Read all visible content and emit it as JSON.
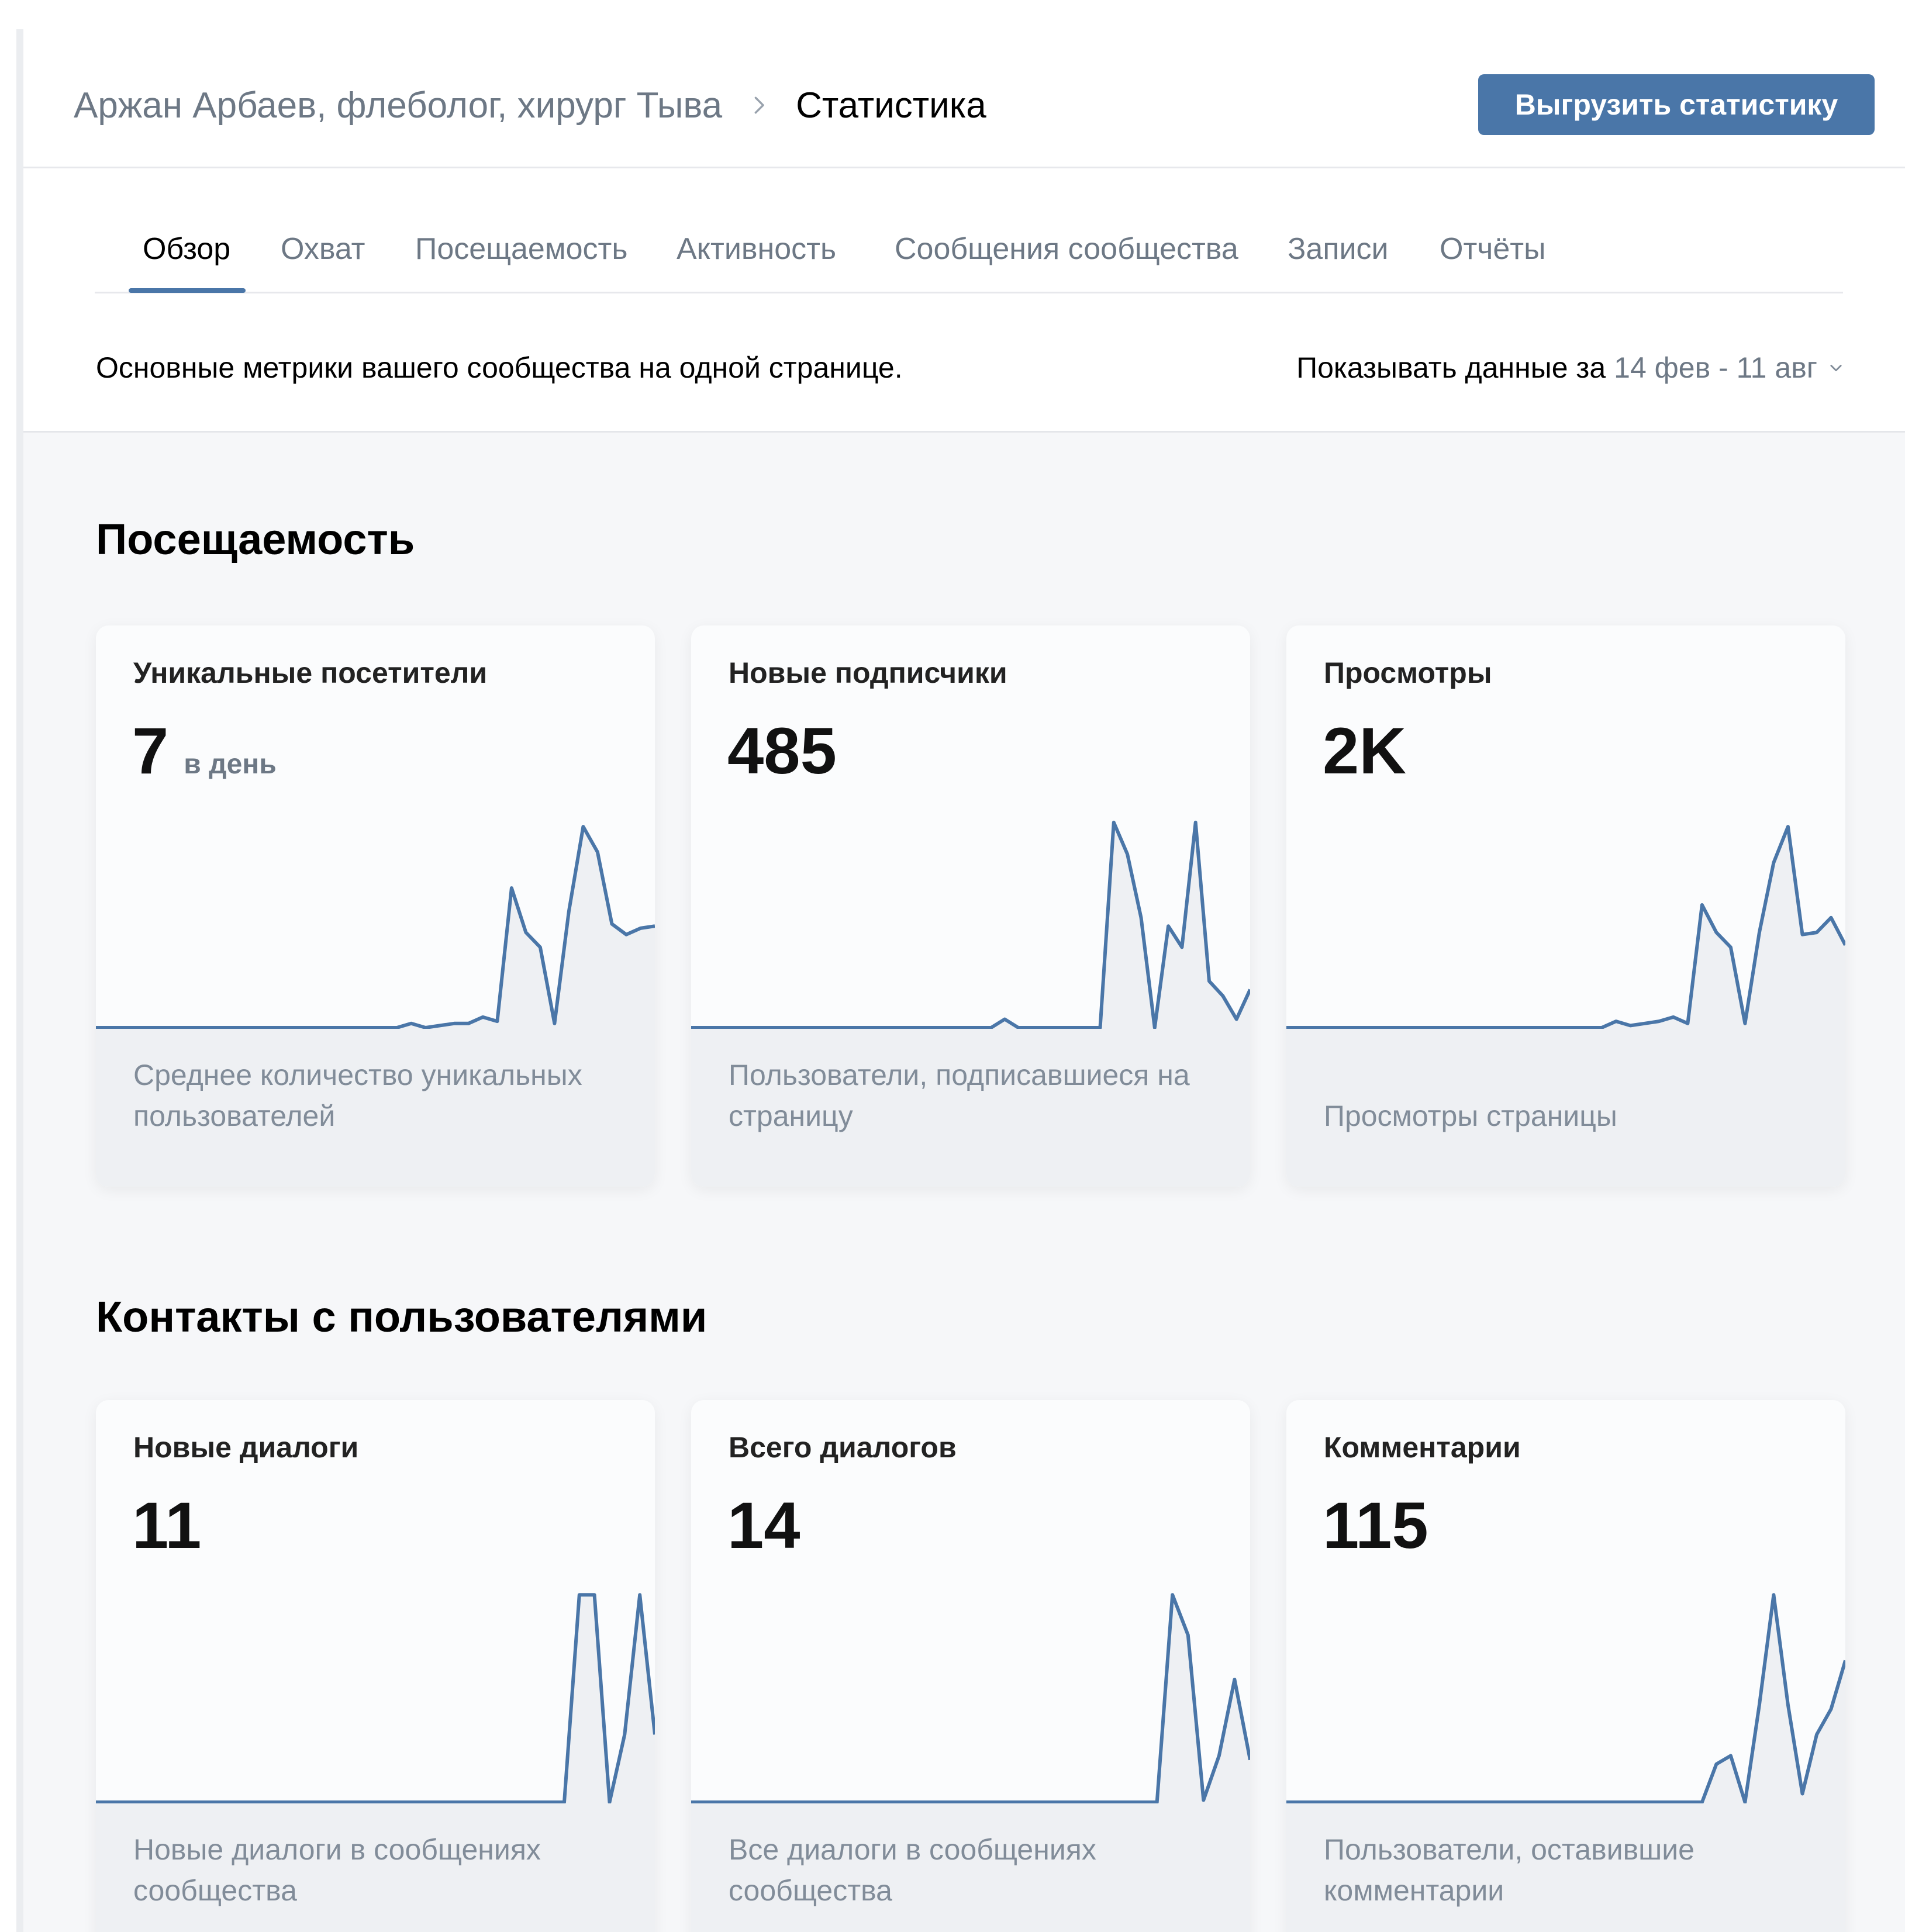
{
  "header": {
    "breadcrumb_parent": "Аржан Арбаев, флеболог, хирург Тыва",
    "breadcrumb_current": "Статистика",
    "export_button": "Выгрузить статистику"
  },
  "tabs": [
    {
      "label": "Обзор",
      "active": true
    },
    {
      "label": "Охват",
      "active": false
    },
    {
      "label": "Посещаемость",
      "active": false
    },
    {
      "label": "Активность",
      "active": false
    },
    {
      "label": "Сообщения сообщества",
      "active": false
    },
    {
      "label": "Записи",
      "active": false
    },
    {
      "label": "Отчёты",
      "active": false
    }
  ],
  "description": "Основные метрики вашего сообщества на одной странице.",
  "period": {
    "label": "Показывать данные за",
    "value": "14 фев - 11 авг"
  },
  "colors": {
    "accent": "#4a76a8",
    "line": "#4a76a8",
    "muted": "#818c99"
  },
  "sections": [
    {
      "title": "Посещаемость",
      "cards": [
        {
          "title": "Уникальные посетители",
          "value": "7",
          "unit": "в день",
          "caption": "Среднее количество уникальных пользователей",
          "series": [
            0,
            0,
            0,
            0,
            0,
            0,
            0,
            0,
            0,
            0,
            0,
            0,
            0,
            0,
            0,
            0,
            0,
            0,
            0,
            0,
            0,
            0,
            0.02,
            0,
            0.01,
            0.02,
            0.02,
            0.05,
            0.03,
            0.66,
            0.45,
            0.38,
            0.02,
            0.55,
            0.95,
            0.83,
            0.49,
            0.44,
            0.47,
            0.48
          ]
        },
        {
          "title": "Новые подписчики",
          "value": "485",
          "unit": "",
          "caption": "Пользователи, подписавшиеся на страницу",
          "series": [
            0,
            0,
            0,
            0,
            0,
            0,
            0,
            0,
            0,
            0,
            0,
            0,
            0,
            0,
            0,
            0,
            0,
            0,
            0,
            0,
            0,
            0,
            0,
            0.04,
            0,
            0,
            0,
            0,
            0,
            0,
            0,
            0.97,
            0.82,
            0.52,
            0,
            0.48,
            0.38,
            0.97,
            0.22,
            0.15,
            0.04,
            0.18
          ]
        },
        {
          "title": "Просмотры",
          "value": "2K",
          "unit": "",
          "caption": "Просмотры страницы",
          "series": [
            0,
            0,
            0,
            0,
            0,
            0,
            0,
            0,
            0,
            0,
            0,
            0,
            0,
            0,
            0,
            0,
            0,
            0,
            0,
            0,
            0,
            0,
            0,
            0.03,
            0.01,
            0.02,
            0.03,
            0.05,
            0.02,
            0.58,
            0.45,
            0.38,
            0.02,
            0.45,
            0.78,
            0.95,
            0.44,
            0.45,
            0.52,
            0.39
          ]
        }
      ]
    },
    {
      "title": "Контакты с пользователями",
      "cards": [
        {
          "title": "Новые диалоги",
          "value": "11",
          "unit": "",
          "caption": "Новые диалоги в сообщениях сообщества",
          "series": [
            0,
            0,
            0,
            0,
            0,
            0,
            0,
            0,
            0,
            0,
            0,
            0,
            0,
            0,
            0,
            0,
            0,
            0,
            0,
            0,
            0,
            0,
            0,
            0,
            0,
            0,
            0,
            0,
            0,
            0,
            0,
            0,
            0.98,
            0.98,
            0,
            0.32,
            0.98,
            0.32
          ]
        },
        {
          "title": "Всего диалогов",
          "value": "14",
          "unit": "",
          "caption": "Все диалоги в сообщениях сообщества",
          "series": [
            0,
            0,
            0,
            0,
            0,
            0,
            0,
            0,
            0,
            0,
            0,
            0,
            0,
            0,
            0,
            0,
            0,
            0,
            0,
            0,
            0,
            0,
            0,
            0,
            0,
            0,
            0,
            0,
            0,
            0,
            0,
            0.98,
            0.79,
            0.01,
            0.22,
            0.58,
            0.2
          ]
        },
        {
          "title": "Комментарии",
          "value": "115",
          "unit": "",
          "caption": "Пользователи, оставившие комментарии",
          "series": [
            0,
            0,
            0,
            0,
            0,
            0,
            0,
            0,
            0,
            0,
            0,
            0,
            0,
            0,
            0,
            0,
            0,
            0,
            0,
            0,
            0,
            0,
            0,
            0,
            0,
            0,
            0,
            0,
            0,
            0,
            0.18,
            0.22,
            0,
            0.46,
            0.98,
            0.46,
            0.04,
            0.32,
            0.44,
            0.67
          ]
        }
      ]
    }
  ]
}
